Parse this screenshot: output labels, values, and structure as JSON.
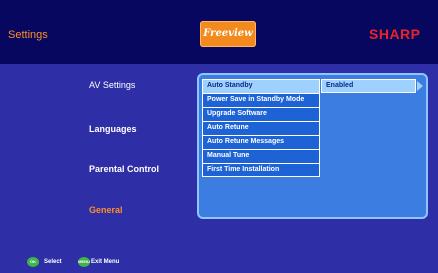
{
  "header": {
    "title": "Settings",
    "freeview_logo": "Freeview",
    "brand": "SHARP"
  },
  "left_menu": [
    {
      "label": "AV Settings"
    },
    {
      "label": "Languages"
    },
    {
      "label": "Parental Control"
    },
    {
      "label": "General"
    }
  ],
  "submenu": {
    "items": [
      "Auto Standby",
      "Power Save in Standby Mode",
      "Upgrade Software",
      "Auto Retune",
      "Auto Retune Messages",
      "Manual Tune",
      "First Time Installation"
    ],
    "selected_index": 0,
    "selected_value": "Enabled"
  },
  "footer": {
    "select_label": "Select",
    "select_icon_text": "OK",
    "exit_label": "Exit Menu",
    "exit_icon_text": "MENU"
  },
  "colors": {
    "background": "#2e2fa6",
    "header": "#07075f",
    "accent_orange": "#ff8c2a",
    "brand_red": "#e8232a",
    "panel": "#3b7de0",
    "highlight": "#9fd1ff",
    "button_green": "#3fb44a"
  }
}
